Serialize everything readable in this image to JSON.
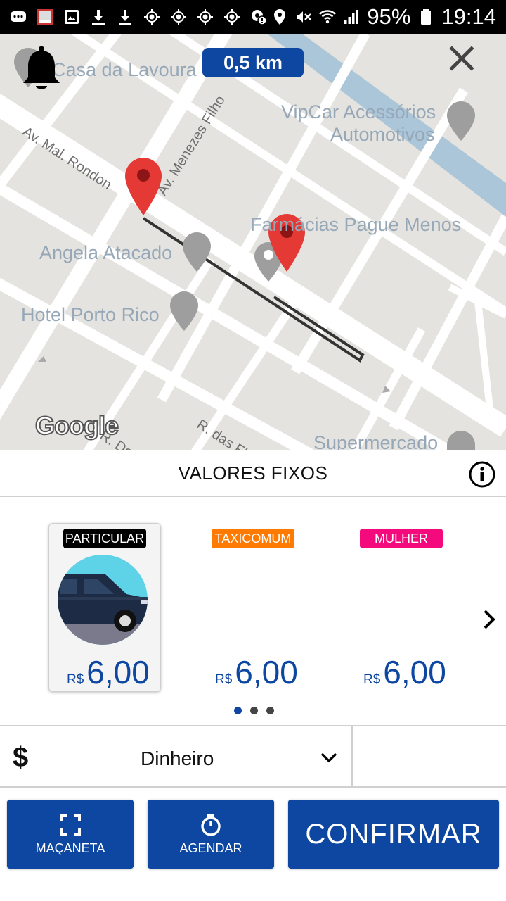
{
  "status_bar": {
    "battery": "95%",
    "time": "19:14",
    "icons": [
      "message-icon",
      "image-icon",
      "gallery-icon",
      "download-icon",
      "download-icon",
      "gps-icon",
      "gps-icon",
      "gps-icon",
      "gps-icon",
      "location-warning-icon",
      "location-icon",
      "mute-icon",
      "wifi-icon",
      "signal-icon",
      "battery-icon"
    ]
  },
  "map": {
    "distance": "0,5 km",
    "places": [
      "Casa da Lavoura",
      "VipCar Acessórios",
      "Automotivos",
      "Farmácias Pague Menos",
      "Angela Atacado",
      "Hotel Porto Rico",
      "Supermercado"
    ],
    "streets": [
      "Av. Mal. Rondon",
      "Av. Menezes Filho",
      "R. das Fl...",
      "R. Do..."
    ],
    "attribution": "Google",
    "colors": {
      "route": "#333333",
      "marker": "#e53935",
      "road": "#ffffff",
      "background": "#e5e3df",
      "water": "#aac6d8"
    }
  },
  "section": {
    "title": "VALORES FIXOS"
  },
  "categories": [
    {
      "tag": "PARTICULAR",
      "tag_color": "#000000",
      "currency": "R$",
      "price": "6,00",
      "selected": true
    },
    {
      "tag": "TAXICOMUM",
      "tag_color": "#ff7a00",
      "currency": "R$",
      "price": "6,00",
      "selected": false
    },
    {
      "tag": "MULHER",
      "tag_color": "#f50a7e",
      "currency": "R$",
      "price": "6,00",
      "selected": false
    }
  ],
  "pagination": {
    "count": 3,
    "active": 1
  },
  "payment": {
    "currency_symbol": "$",
    "method": "Dinheiro"
  },
  "buttons": {
    "handle": "MAÇANETA",
    "schedule": "AGENDAR",
    "confirm": "CONFIRMAR"
  },
  "accent_color": "#0d47a1"
}
